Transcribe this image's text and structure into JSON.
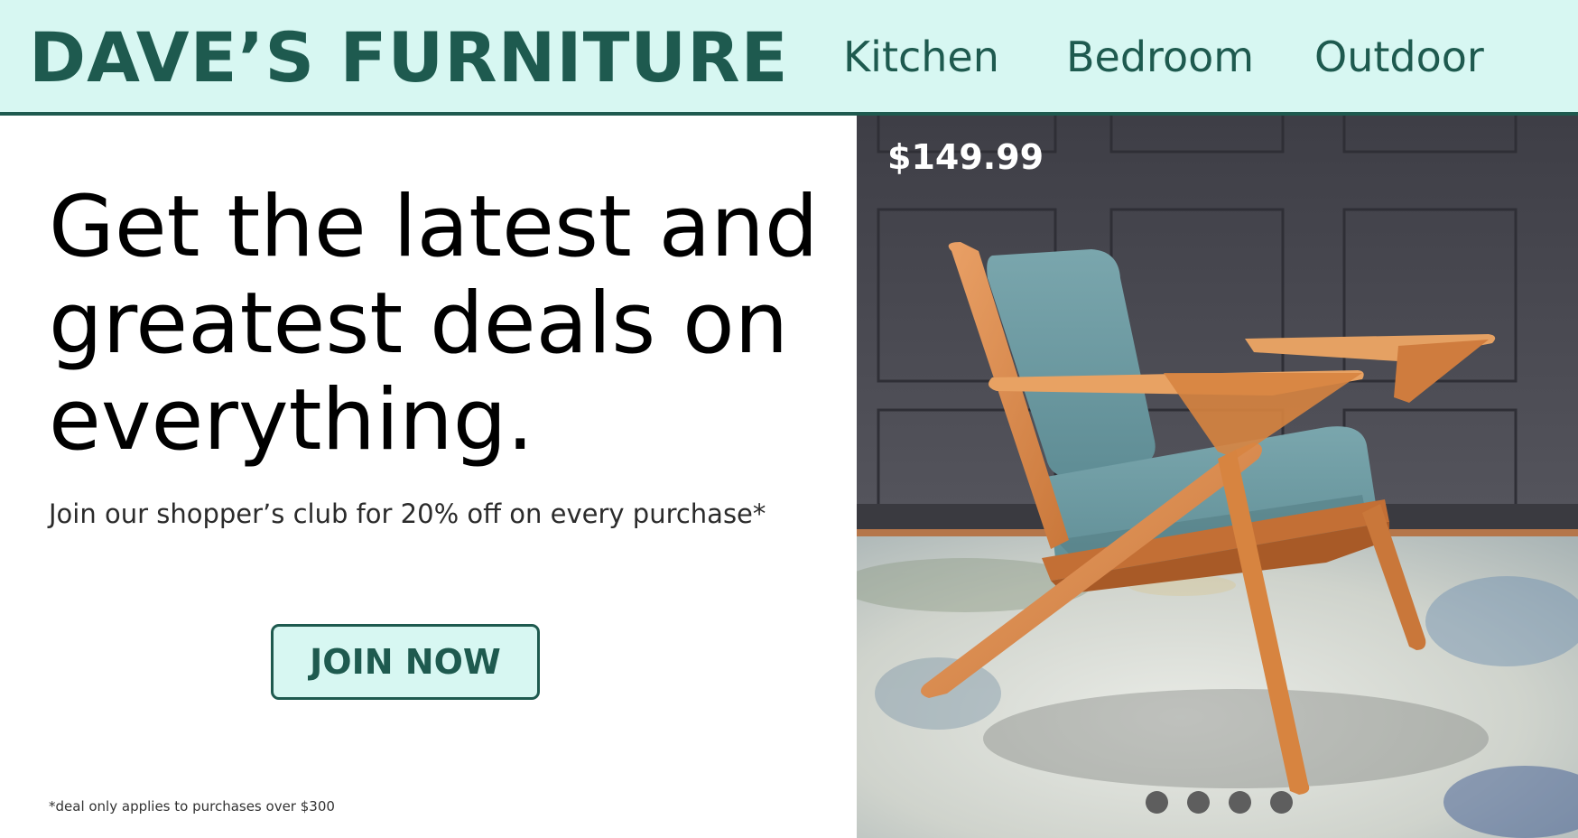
{
  "brand": {
    "name": "DAVE’S FURNITURE"
  },
  "nav": {
    "items": [
      {
        "label": "Kitchen"
      },
      {
        "label": "Bedroom"
      },
      {
        "label": "Outdoor"
      }
    ]
  },
  "promo": {
    "headline": "Get the latest and greatest deals on everything.",
    "subline": "Join our shopper’s club for 20% off on every purchase*",
    "cta_label": "JOIN NOW",
    "footnote": "*deal only applies to purchases over $300"
  },
  "hero": {
    "price": "$149.99",
    "carousel_count": 4
  },
  "colors": {
    "brand": "#1e5a4f",
    "header_bg": "#d7f7f2",
    "wall": "#47474f",
    "wood": "#d9894a",
    "cushion": "#6f9ca3"
  }
}
